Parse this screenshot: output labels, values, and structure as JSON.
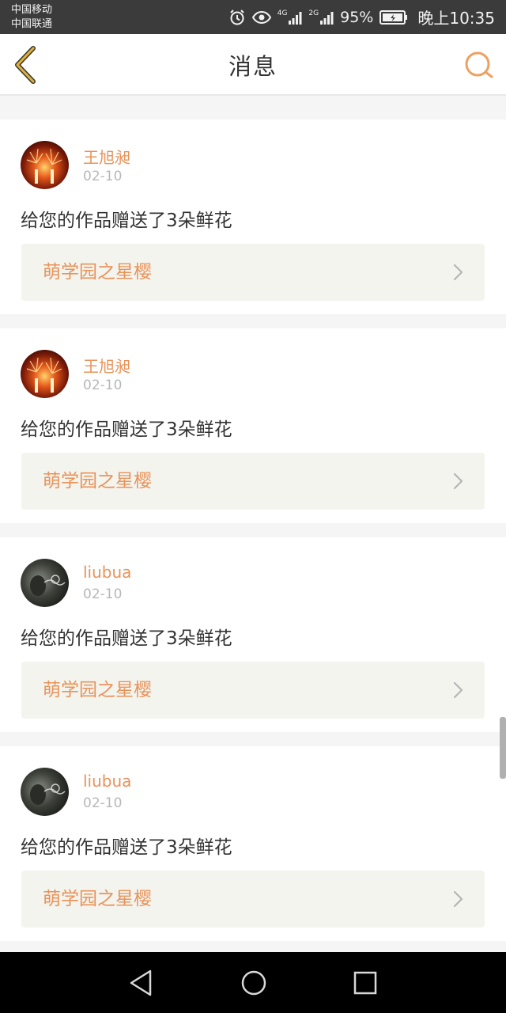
{
  "status_bar": {
    "carrier_1": "中国移动",
    "carrier_2": "中国联通",
    "net_1": "4G",
    "net_2": "2G",
    "battery": "95%",
    "time": "晚上10:35"
  },
  "header": {
    "title": "消息"
  },
  "messages": [
    {
      "username": "王旭昶",
      "date": "02-10",
      "text": "给您的作品赠送了3朵鲜花",
      "work_title": "萌学园之星樱",
      "avatar_style": "fireworks"
    },
    {
      "username": "王旭昶",
      "date": "02-10",
      "text": "给您的作品赠送了3朵鲜花",
      "work_title": "萌学园之星樱",
      "avatar_style": "fireworks"
    },
    {
      "username": "liubua",
      "date": "02-10",
      "text": "给您的作品赠送了3朵鲜花",
      "work_title": "萌学园之星樱",
      "avatar_style": "smoke"
    },
    {
      "username": "liubua",
      "date": "02-10",
      "text": "给您的作品赠送了3朵鲜花",
      "work_title": "萌学园之星樱",
      "avatar_style": "smoke"
    }
  ],
  "colors": {
    "accent": "#e8935a",
    "back_icon": "#d9a44f",
    "link_bg": "#f4f4ef"
  }
}
